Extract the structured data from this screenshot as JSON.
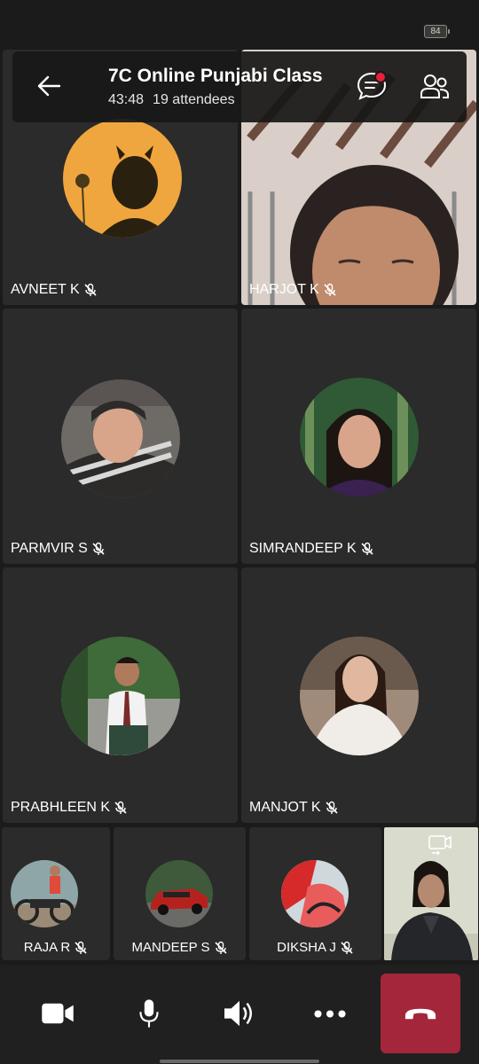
{
  "status": {
    "battery": "84"
  },
  "meeting": {
    "title": "7C Online Punjabi Class",
    "duration": "43:48",
    "attendees": "19 attendees"
  },
  "participants": {
    "avneet": "AVNEET K",
    "harjot": "HARJOT K",
    "parmvir": "PARMVIR S",
    "simrandeep": "SIMRANDEEP K",
    "prabhleen": "PRABHLEEN K",
    "manjot": "MANJOT K",
    "raja": "RAJA R",
    "mandeep": "MANDEEP S",
    "diksha": "DIKSHA J"
  },
  "icons": {
    "back": "arrow-left-icon",
    "chat": "chat-icon",
    "people": "people-icon",
    "mute": "mic-off-icon",
    "switch_camera": "switch-camera-icon",
    "video": "video-camera-icon",
    "mic": "microphone-icon",
    "speaker": "speaker-icon",
    "more": "more-icon",
    "hangup": "hang-up-icon"
  },
  "colors": {
    "background": "#1b1b1b",
    "tile": "#2b2b2b",
    "end_call": "#a4263a",
    "notification": "#e8203a"
  }
}
